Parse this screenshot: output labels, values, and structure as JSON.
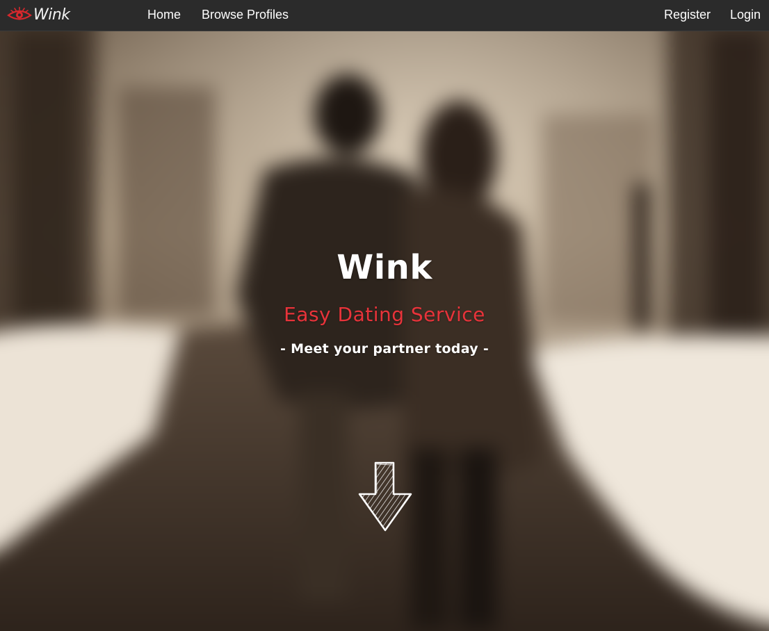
{
  "brand": {
    "name": "Wink",
    "logo_icon": "eye-icon",
    "accent_color": "#d8282d"
  },
  "nav": {
    "home": "Home",
    "browse_profiles": "Browse Profiles",
    "register": "Register",
    "login": "Login"
  },
  "hero": {
    "title": "Wink",
    "subtitle": "Easy Dating Service",
    "tagline": "- Meet your partner today -",
    "subtitle_color": "#e8333a",
    "scroll_icon": "arrow-down-icon"
  }
}
